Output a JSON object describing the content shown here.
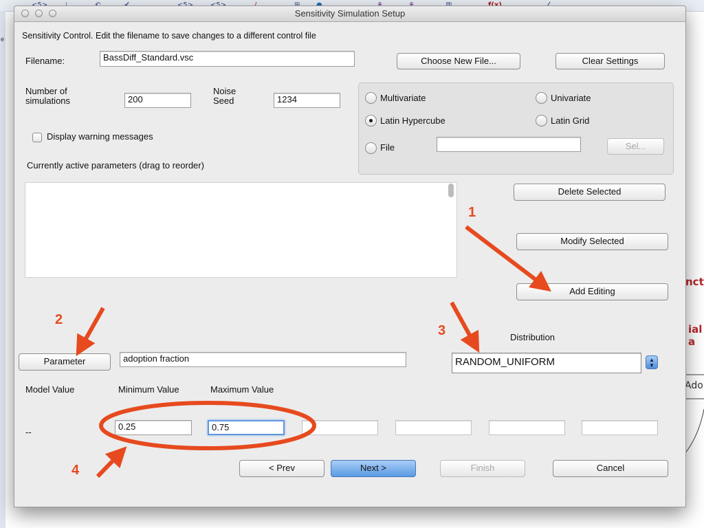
{
  "background_app": {
    "toolbar_icons": [
      "<5>",
      "⊥",
      "↶",
      "⊀",
      "<5>",
      "<5>",
      "∕",
      "⊞",
      "●",
      "⚘",
      "⚘",
      "▥",
      "f(x)",
      "∠"
    ],
    "side_text_right": [
      "ncti",
      "ial a",
      "Ado"
    ],
    "left_label": "e"
  },
  "dialog": {
    "title": "Sensitivity Simulation Setup",
    "instruction": "Sensitivity Control.  Edit the filename to save changes to a different control file",
    "filename_label": "Filename:",
    "filename_value": "BassDiff_Standard.vsc",
    "choose_file_label": "Choose New File...",
    "clear_settings_label": "Clear Settings",
    "num_sims_label": "Number of simulations",
    "num_sims_value": "200",
    "noise_seed_label": "Noise Seed",
    "noise_seed_value": "1234",
    "display_warnings_label": "Display warning messages",
    "active_params_label": "Currently active parameters (drag to reorder)",
    "methods": {
      "multivariate": "Multivariate",
      "univariate": "Univariate",
      "latin_hypercube": "Latin Hypercube",
      "latin_grid": "Latin Grid",
      "file": "File",
      "file_value": "",
      "sel_label": "Sel...",
      "selected": "Latin Hypercube"
    },
    "delete_selected_label": "Delete Selected",
    "modify_selected_label": "Modify Selected",
    "add_editing_label": "Add Editing",
    "distribution_label": "Distribution",
    "distribution_value": "RANDOM_UNIFORM",
    "parameter_button_label": "Parameter",
    "parameter_value": "adoption fraction",
    "model_value_label": "Model Value",
    "min_value_label": "Minimum Value",
    "max_value_label": "Maximum Value",
    "model_value": "--",
    "min_value": "0.25",
    "max_value": "0.75",
    "extra_fields": [
      "",
      "",
      "",
      ""
    ],
    "prev_label": "< Prev",
    "next_label": "Next >",
    "finish_label": "Finish",
    "cancel_label": "Cancel"
  },
  "annotations": {
    "n1": "1",
    "n2": "2",
    "n3": "3",
    "n4": "4",
    "color": "#e64a1e"
  }
}
